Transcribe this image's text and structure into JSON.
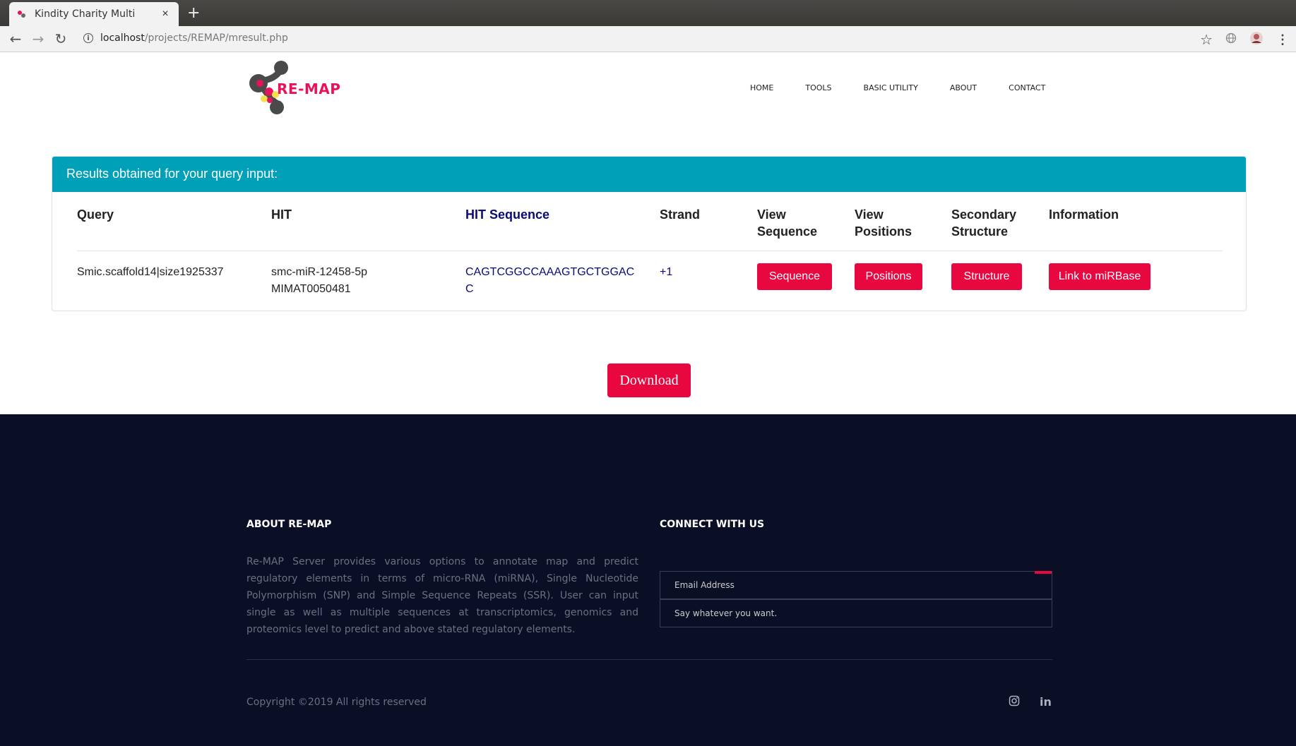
{
  "browser": {
    "tab_title": "Kindity Charity Multi",
    "tab_close": "×",
    "new_tab": "+",
    "url_host": "localhost",
    "url_path": "/projects/REMAP/mresult.php",
    "back_icon": "←",
    "forward_icon": "→",
    "reload_icon": "↻",
    "star_icon": "☆"
  },
  "header": {
    "logo_text": "RE-MAP",
    "nav": [
      "HOME",
      "TOOLS",
      "BASIC UTILITY",
      "ABOUT",
      "CONTACT"
    ]
  },
  "results": {
    "heading": "Results obtained for your query input:",
    "columns": [
      "Query",
      "HIT",
      "HIT Sequence",
      "Strand",
      "View Sequence",
      "View Positions",
      "Secondary Structure",
      "Information"
    ],
    "row": {
      "query": "Smic.scaffold14|size1925337",
      "hit_line1": "smc-miR-12458-5p",
      "hit_line2": "MIMAT0050481",
      "sequence_line1": "CAGTCGGCCAAAGTGCTGGAC",
      "sequence_line2": "C",
      "strand": "+1",
      "btn_sequence": "Sequence",
      "btn_positions": "Positions",
      "btn_structure": "Structure",
      "btn_mirbase": "Link to miRBase"
    }
  },
  "download_label": "Download",
  "footer": {
    "about_title": "ABOUT RE-MAP",
    "about_text": "Re-MAP Server provides various options to annotate map and predict regulatory elements in terms of micro-RNA (miRNA), Single Nucleotide Polymorphism (SNP) and Simple Sequence Repeats (SSR). User can input single as well as multiple sequences at transcriptomics, genomics and proteomics level to predict and above stated regulatory elements.",
    "connect_title": "CONNECT WITH US",
    "email_placeholder": "Email Address",
    "message_placeholder": "Say whatever you want.",
    "copyright": "Copyright ©2019 All rights reserved",
    "social_instagram": "◎",
    "social_linkedin": "in"
  },
  "colors": {
    "accent": "#e8073f",
    "panel_header": "#00a0b9",
    "footer_bg": "#0b0f25",
    "sequence_blue": "#0a0a78"
  }
}
